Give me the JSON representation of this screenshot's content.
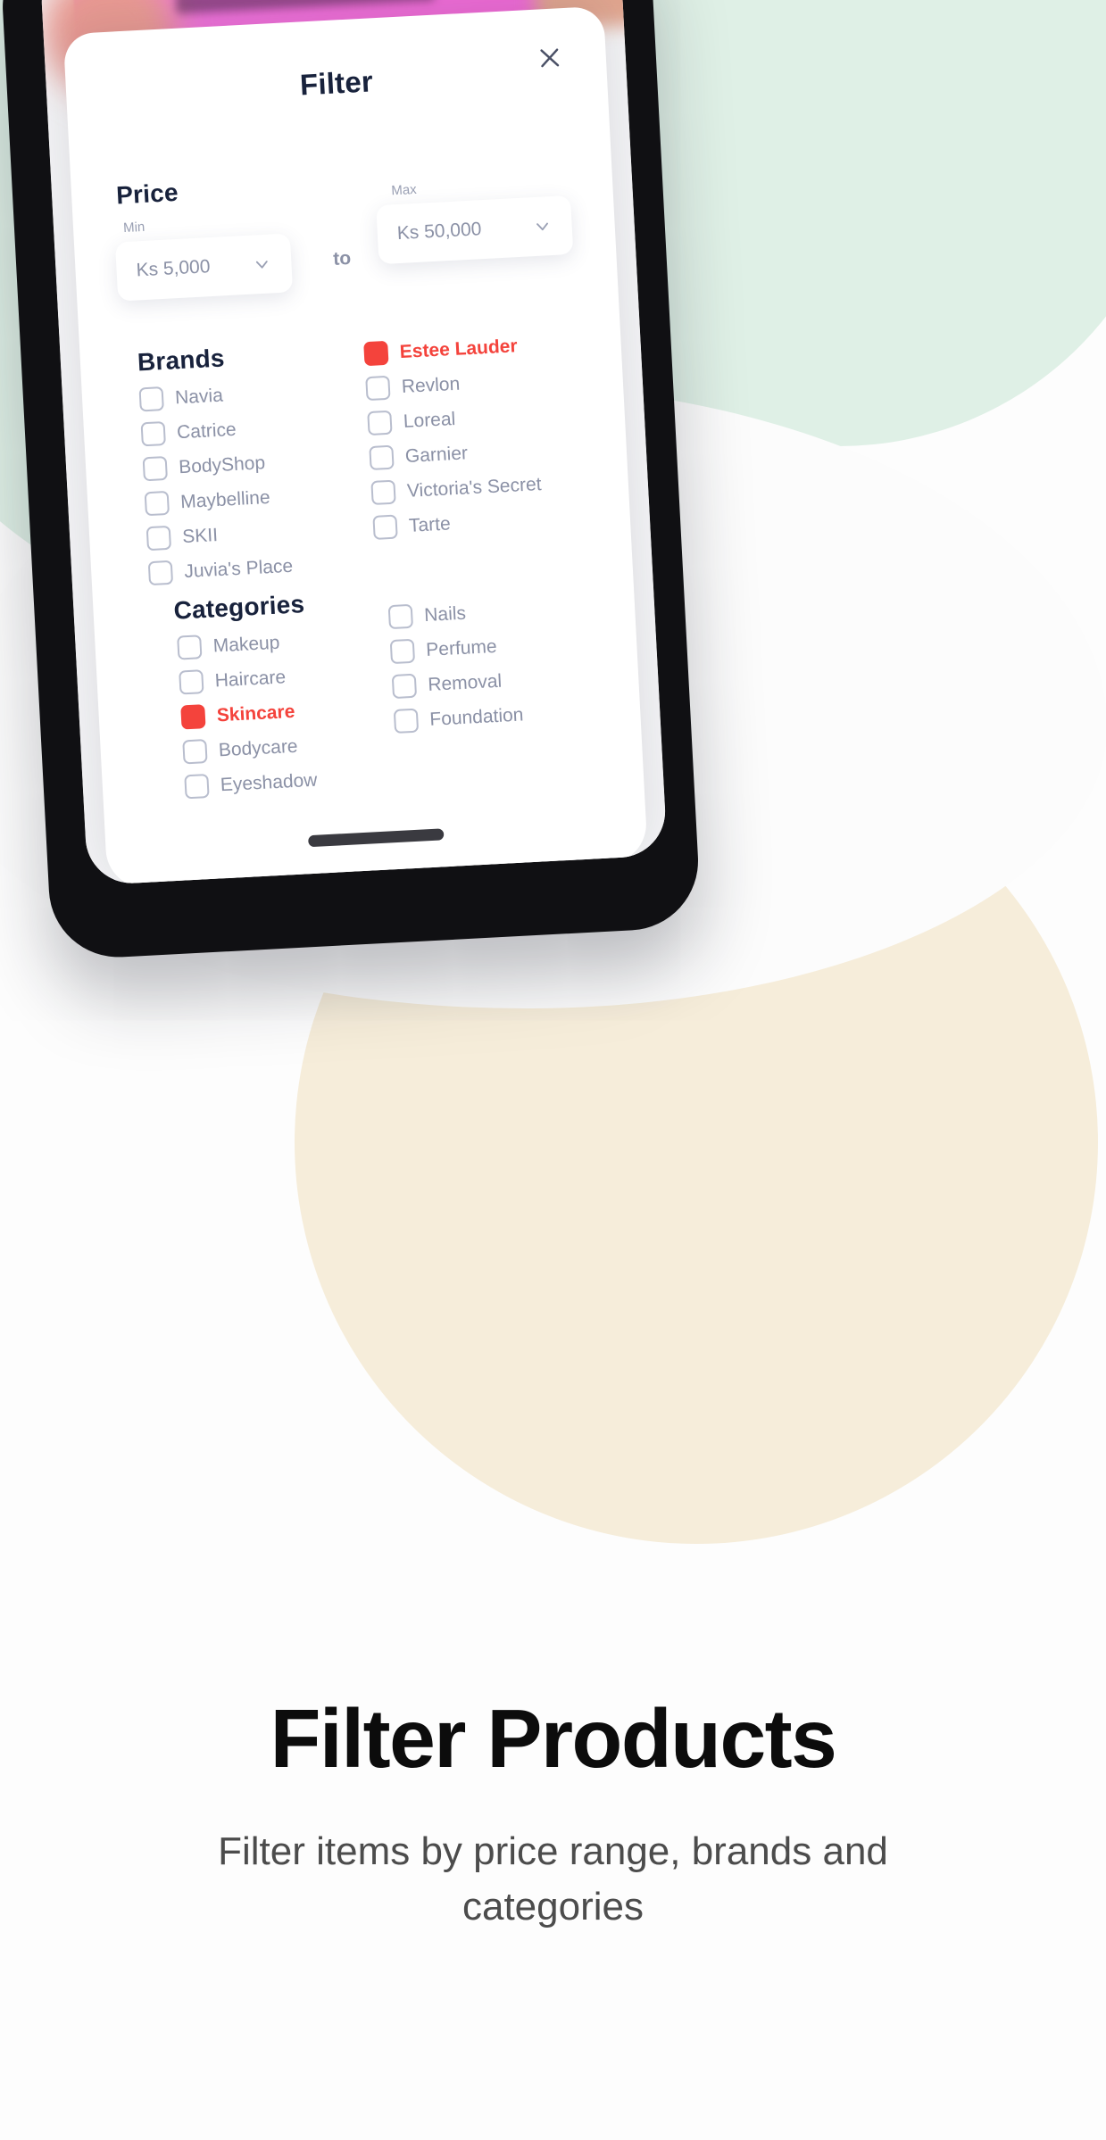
{
  "sheet": {
    "title": "Filter",
    "close_icon": "close-icon",
    "price": {
      "section_title": "Price",
      "min_label": "Min",
      "min_value": "Ks 5,000",
      "separator": "to",
      "max_label": "Max",
      "max_value": "Ks 50,000",
      "chevron_icon": "chevron-down-icon"
    },
    "brands": {
      "section_title": "Brands",
      "left": [
        {
          "label": "Navia",
          "checked": false
        },
        {
          "label": "Catrice",
          "checked": false
        },
        {
          "label": "BodyShop",
          "checked": false
        },
        {
          "label": "Maybelline",
          "checked": false
        },
        {
          "label": "SKII",
          "checked": false
        },
        {
          "label": "Juvia's Place",
          "checked": false
        }
      ],
      "right": [
        {
          "label": "Estee Lauder",
          "checked": true
        },
        {
          "label": "Revlon",
          "checked": false
        },
        {
          "label": "Loreal",
          "checked": false
        },
        {
          "label": "Garnier",
          "checked": false
        },
        {
          "label": "Victoria's Secret",
          "checked": false
        },
        {
          "label": "Tarte",
          "checked": false
        }
      ]
    },
    "categories": {
      "section_title": "Categories",
      "left": [
        {
          "label": "Makeup",
          "checked": false
        },
        {
          "label": "Haircare",
          "checked": false
        },
        {
          "label": "Skincare",
          "checked": true
        },
        {
          "label": "Bodycare",
          "checked": false
        },
        {
          "label": "Eyeshadow",
          "checked": false
        }
      ],
      "right": [
        {
          "label": "Nails",
          "checked": false
        },
        {
          "label": "Perfume",
          "checked": false
        },
        {
          "label": "Removal",
          "checked": false
        },
        {
          "label": "Foundation",
          "checked": false
        }
      ]
    }
  },
  "caption": {
    "headline": "Filter Products",
    "subline": "Filter items by price range, brands and categories"
  },
  "colors": {
    "accent": "#f4433c",
    "heading": "#18223c",
    "muted": "#8b91a6",
    "phone": "#101013"
  }
}
